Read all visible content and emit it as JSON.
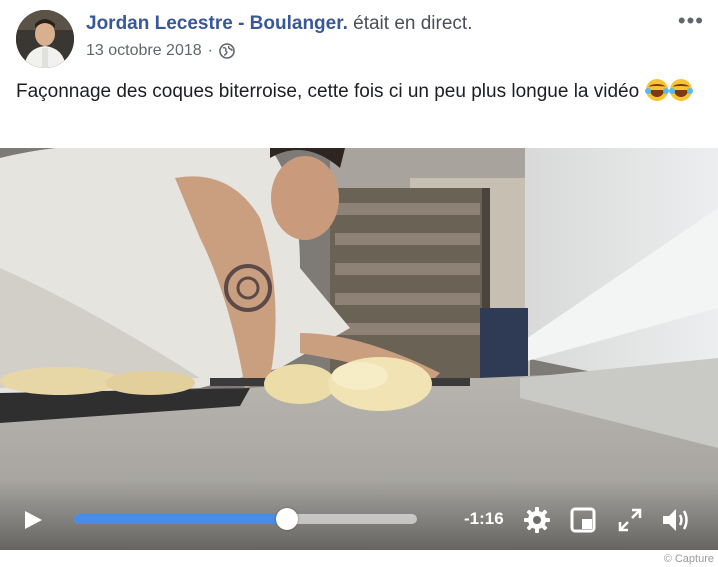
{
  "post": {
    "author": "Jordan Lecestre - Boulanger.",
    "action": "était en direct.",
    "date": "13 octobre 2018",
    "separator": "·",
    "privacy_icon": "globe-icon",
    "more_label": "•••",
    "text": "Façonnage des coques biterroise, cette fois ci un peu plus longue la vidéo",
    "emojis": [
      "tears-of-joy-emoji",
      "tears-of-joy-emoji"
    ]
  },
  "video": {
    "time_remaining": "-1:16",
    "progress": 0.62,
    "controls": [
      "play-icon",
      "settings-icon",
      "miniplayer-icon",
      "fullscreen-icon",
      "volume-icon"
    ]
  },
  "credit": "© Capture",
  "colors": {
    "author": "#385898",
    "progress": "#4a8be8"
  }
}
